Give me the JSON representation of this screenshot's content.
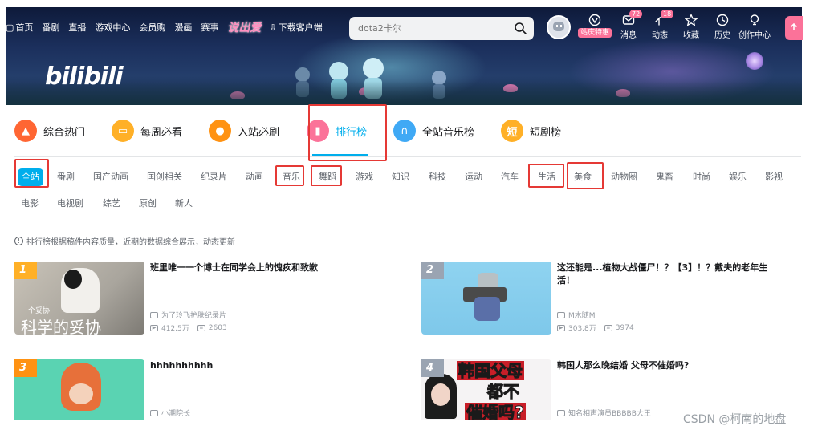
{
  "header": {
    "nav_left": [
      {
        "label": "首页",
        "icon": "tv-icon"
      },
      {
        "label": "番剧"
      },
      {
        "label": "直播"
      },
      {
        "label": "游戏中心"
      },
      {
        "label": "会员购"
      },
      {
        "label": "漫画"
      },
      {
        "label": "赛事"
      }
    ],
    "special_label": "说出爱",
    "download_label": "下载客户端",
    "search": {
      "placeholder": "dota2卡尔",
      "icon": "search-icon"
    },
    "right_nav": [
      {
        "label": "大会员",
        "icon": "vip-icon",
        "tag": "站庆特惠"
      },
      {
        "label": "消息",
        "icon": "message-icon",
        "badge": "72"
      },
      {
        "label": "动态",
        "icon": "dynamic-icon",
        "badge": "18"
      },
      {
        "label": "收藏",
        "icon": "star-icon"
      },
      {
        "label": "历史",
        "icon": "clock-icon"
      },
      {
        "label": "创作中心",
        "icon": "bulb-icon"
      }
    ],
    "logo_text": "bilibili"
  },
  "tabs": [
    {
      "label": "综合热门",
      "icon": "fire-icon",
      "color": "#ff6633"
    },
    {
      "label": "每周必看",
      "icon": "calendar-icon",
      "color": "#ffb027"
    },
    {
      "label": "入站必刷",
      "icon": "medal-icon",
      "color": "#ff9212"
    },
    {
      "label": "排行榜",
      "icon": "rank-icon",
      "color": "#fb7299",
      "active": true
    },
    {
      "label": "全站音乐榜",
      "icon": "headphone-icon",
      "color": "#3fa9f5"
    },
    {
      "label": "短剧榜",
      "icon": "short-drama-icon",
      "color": "#ffb027",
      "icon_text": "短"
    }
  ],
  "channels": {
    "row1": [
      "全站",
      "番剧",
      "国产动画",
      "国创相关",
      "纪录片",
      "动画",
      "音乐",
      "舞蹈",
      "游戏",
      "知识",
      "科技",
      "运动",
      "汽车",
      "生活",
      "美食",
      "动物圈",
      "鬼畜",
      "时尚",
      "娱乐",
      "影视"
    ],
    "row2": [
      "电影",
      "电视剧",
      "综艺",
      "原创",
      "新人"
    ]
  },
  "notice": "排行榜根据稿件内容质量，近期的数据综合展示，动态更新",
  "cards": [
    {
      "rank": "1",
      "title": "班里唯一一个博士在同学会上的愧疚和致歉",
      "up": "为了玲飞护肤纪录片",
      "views": "412.5万",
      "comments": "2603",
      "thumb_caption": "科学的妥协",
      "thumb_caption_small": "一个妥协"
    },
    {
      "rank": "2",
      "title": "这还能是...植物大战僵尸！？【3】！？戴夫的老年生活！",
      "up": "M木随M",
      "views": "303.8万",
      "comments": "3974"
    },
    {
      "rank": "3",
      "title": "hhhhhhhhhh",
      "up": "小潮院长",
      "views": "",
      "comments": ""
    },
    {
      "rank": "4",
      "title": "韩国人那么晚结婚 父母不催婚吗?",
      "up": "知名相声演员BBBBB大王",
      "views": "",
      "comments": "",
      "thumb_caption": "韩国父母",
      "thumb_caption2": "都不",
      "thumb_caption3": "催婚吗?"
    }
  ],
  "watermark": "CSDN @柯南的地盘",
  "colors": {
    "accent": "#00aeec",
    "pink": "#fb7299",
    "annotation": "#e53935"
  }
}
